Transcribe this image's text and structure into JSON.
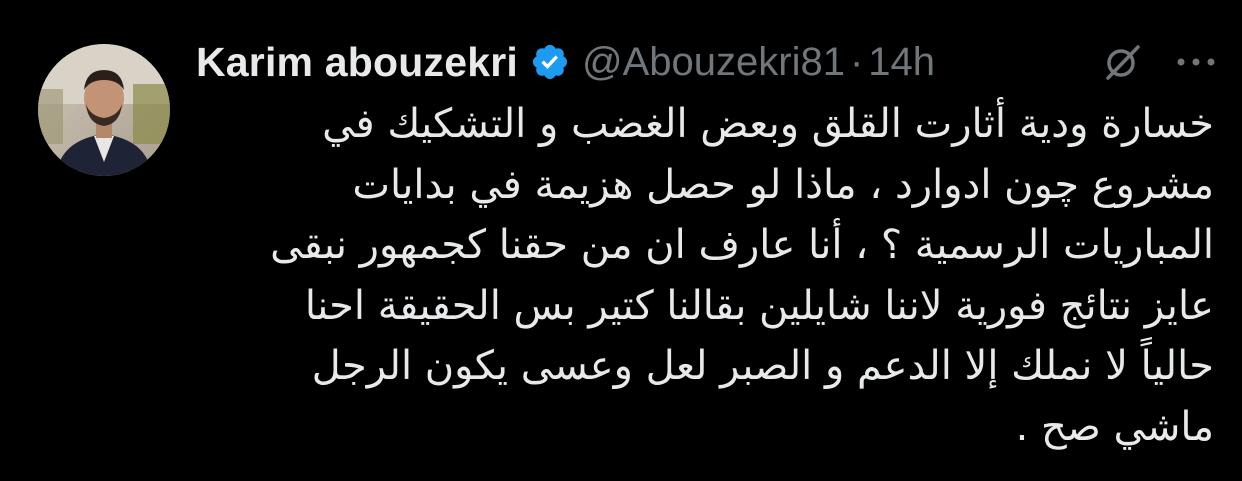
{
  "author": {
    "display_name": "Karim abouzekri",
    "handle": "@Abouzekri81",
    "separator": "·",
    "time": "14h",
    "verified_icon": "verified-badge-icon",
    "avatar_icon": "profile-avatar"
  },
  "toolbar": {
    "grok_icon": "grok-icon",
    "more_icon": "more-options-icon"
  },
  "tweet": {
    "lines": [
      "خسارة ودية أثارت القلق وبعض الغضب و التشكيك في",
      "مشروع چون ادوارد ، ماذا لو حصل هزيمة في بدايات",
      "المباريات الرسمية ؟ ، أنا عارف ان من حقنا كجمهور نبقى",
      "عايز نتائج فورية لاننا شايلين بقالنا كتير بس الحقيقة احنا",
      "حالياً لا نملك إلا الدعم و الصبر لعل وعسى يكون الرجل",
      "ماشي صح ."
    ]
  },
  "colors": {
    "background": "#000000",
    "primary_text": "#e7e9ea",
    "secondary_text": "#71767b",
    "verified_blue": "#1d9bf0"
  }
}
